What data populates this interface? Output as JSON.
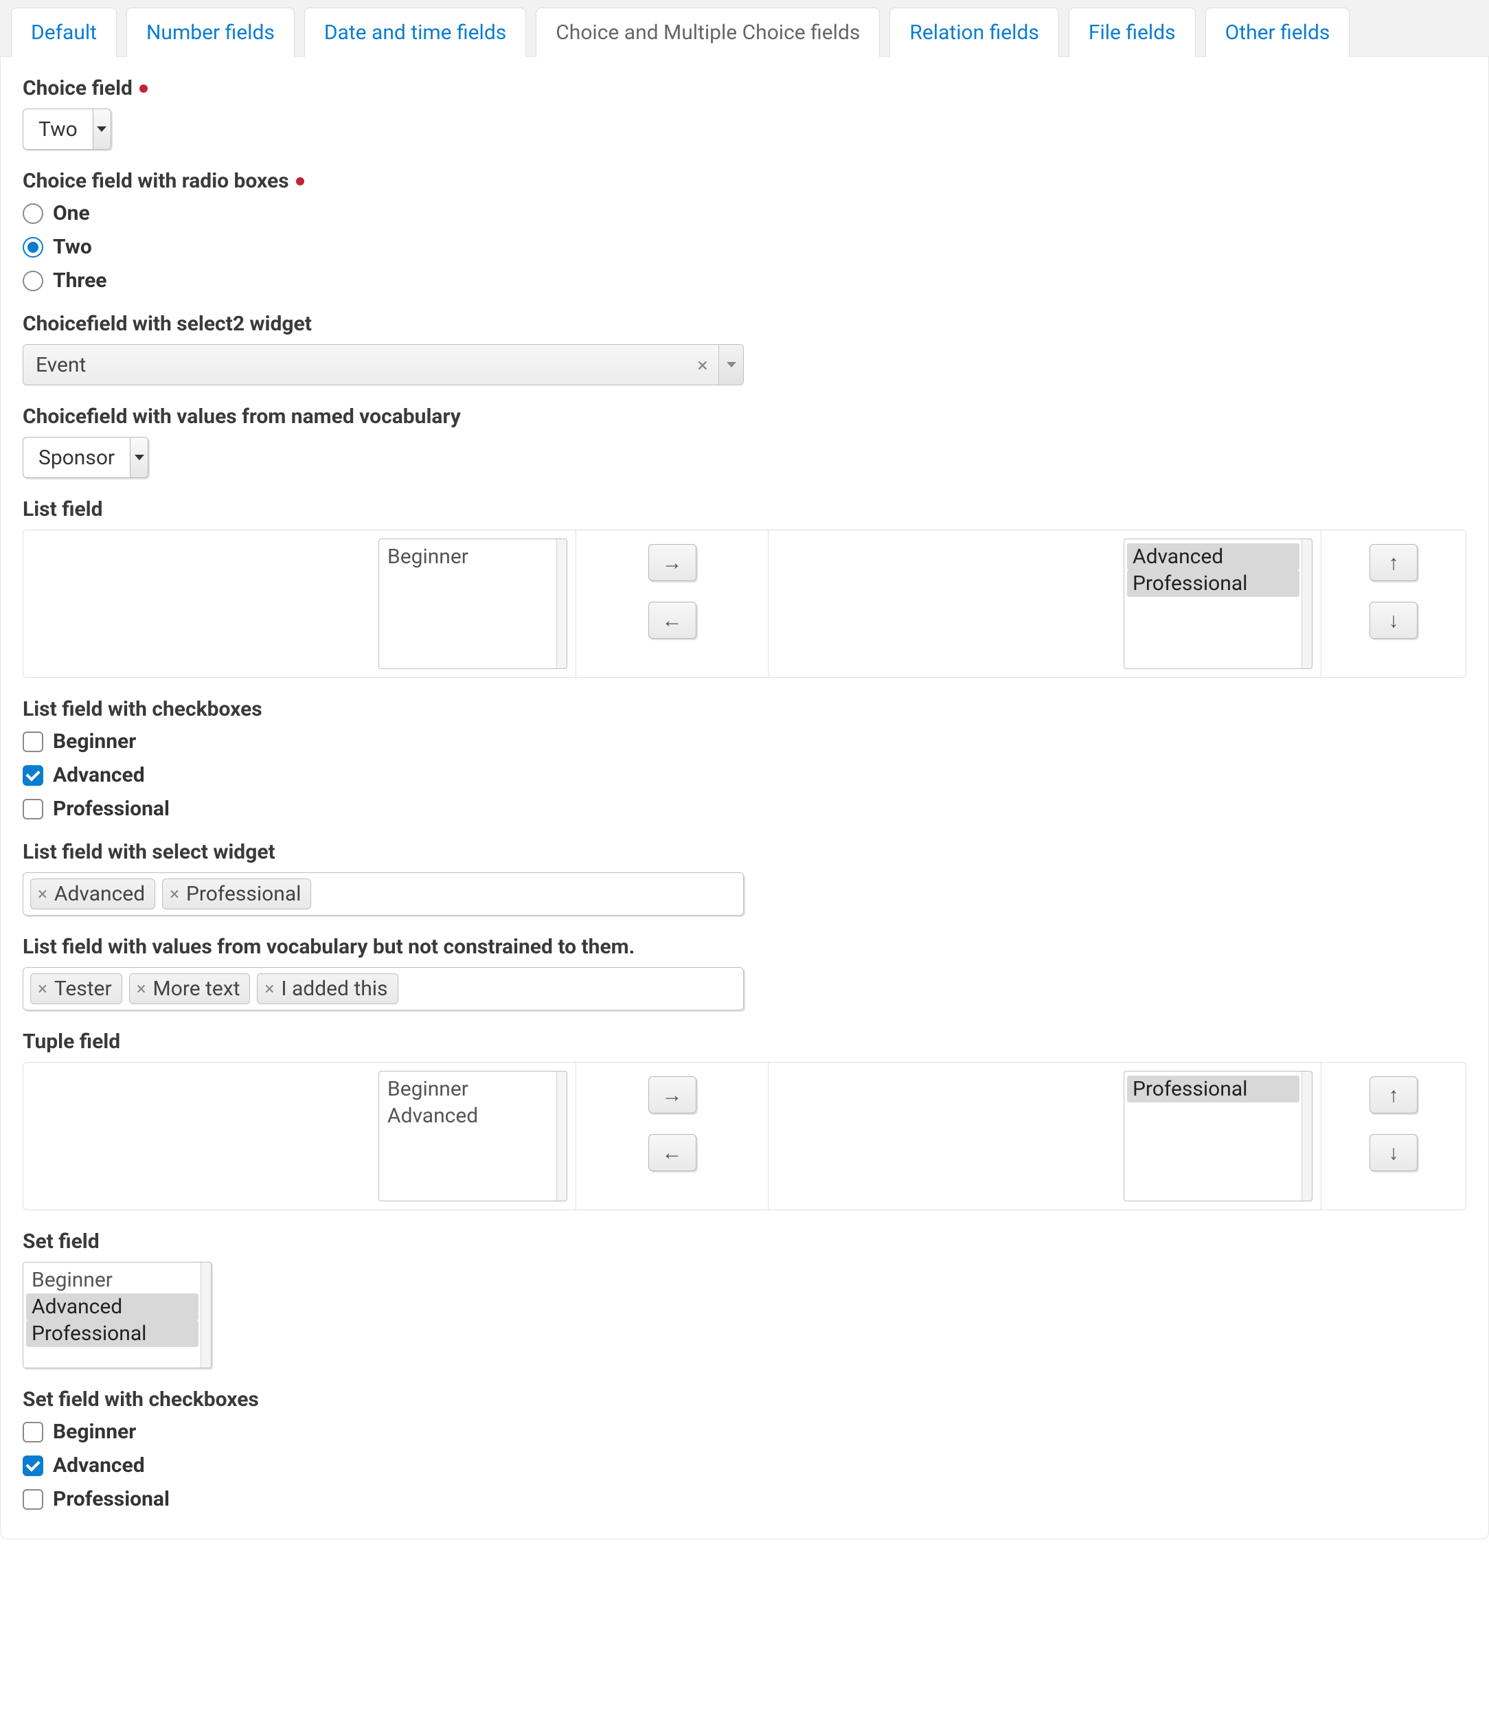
{
  "tabs": [
    {
      "label": "Default"
    },
    {
      "label": "Number fields"
    },
    {
      "label": "Date and time fields"
    },
    {
      "label": "Choice and Multiple Choice fields"
    },
    {
      "label": "Relation fields"
    },
    {
      "label": "File fields"
    },
    {
      "label": "Other fields"
    }
  ],
  "active_tab_index": 3,
  "fields": {
    "choice": {
      "label": "Choice field",
      "required": true,
      "value": "Two"
    },
    "radio": {
      "label": "Choice field with radio boxes",
      "required": true,
      "options": [
        "One",
        "Two",
        "Three"
      ],
      "selected_index": 1
    },
    "select2": {
      "label": "Choicefield with select2 widget",
      "value": "Event"
    },
    "vocab": {
      "label": "Choicefield with values from named vocabulary",
      "value": "Sponsor"
    },
    "listfield": {
      "label": "List field",
      "available": [
        "Beginner"
      ],
      "available_selected": [],
      "chosen": [
        "Advanced",
        "Professional"
      ],
      "chosen_selected": [
        0,
        1
      ]
    },
    "listcheck": {
      "label": "List field with checkboxes",
      "options": [
        "Beginner",
        "Advanced",
        "Professional"
      ],
      "checked": [
        false,
        true,
        false
      ]
    },
    "listselect": {
      "label": "List field with select widget",
      "tokens": [
        "Advanced",
        "Professional"
      ]
    },
    "listvocab": {
      "label": "List field with values from vocabulary but not constrained to them.",
      "tokens": [
        "Tester",
        "More text",
        "I added this"
      ]
    },
    "tuple": {
      "label": "Tuple field",
      "available": [
        "Beginner",
        "Advanced"
      ],
      "available_selected": [],
      "chosen": [
        "Professional"
      ],
      "chosen_selected": [
        0
      ]
    },
    "set": {
      "label": "Set field",
      "options": [
        "Beginner",
        "Advanced",
        "Professional"
      ],
      "selected": [
        false,
        true,
        true
      ]
    },
    "setcheck": {
      "label": "Set field with checkboxes",
      "options": [
        "Beginner",
        "Advanced",
        "Professional"
      ],
      "checked": [
        false,
        true,
        false
      ]
    }
  },
  "arrows": {
    "right": "→",
    "left": "←",
    "up": "↑",
    "down": "↓",
    "x": "×"
  }
}
